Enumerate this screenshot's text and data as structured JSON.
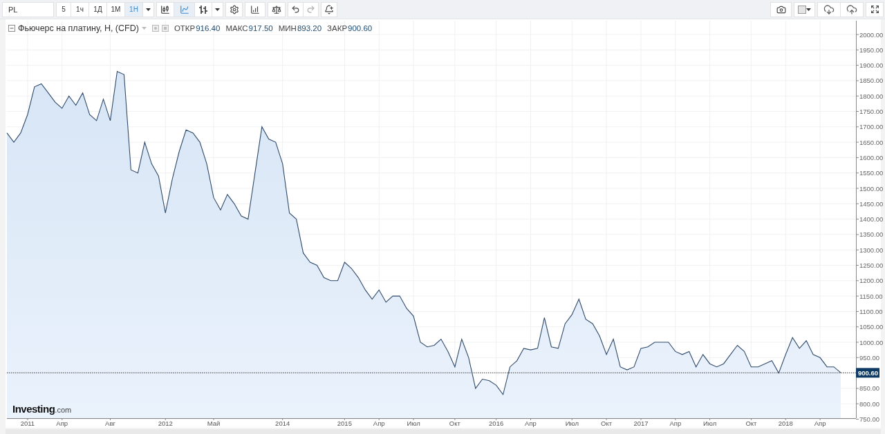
{
  "toolbar": {
    "symbol": {
      "value": "PL"
    },
    "intervals": [
      {
        "label": "5",
        "selected": false
      },
      {
        "label": "1ч",
        "selected": false
      },
      {
        "label": "1Д",
        "selected": false
      },
      {
        "label": "1М",
        "selected": false
      },
      {
        "label": "1Н",
        "selected": true
      }
    ],
    "chart_types": [
      {
        "kind": "candles",
        "selected": false
      },
      {
        "kind": "line",
        "selected": true
      },
      {
        "kind": "bars",
        "selected": false
      }
    ]
  },
  "legend": {
    "title": "Фьючерс на платину, Н, (CFD)",
    "stats": [
      {
        "label": "ОТКР",
        "value": "916.40"
      },
      {
        "label": "МАКС",
        "value": "917.50"
      },
      {
        "label": "МИН",
        "value": "893.20"
      },
      {
        "label": "ЗАКР",
        "value": "900.60"
      }
    ]
  },
  "chart": {
    "logo": {
      "name": "Investing",
      "suffix": ".com"
    },
    "chart_data": {
      "type": "area",
      "grid": true,
      "ref_lines": [
        {
          "axis": "y",
          "value": 900.6,
          "label": "900.60"
        }
      ],
      "categories": [
        null,
        null,
        null,
        "2011",
        null,
        null,
        null,
        null,
        "Апр",
        null,
        null,
        null,
        null,
        null,
        null,
        "Авг",
        null,
        null,
        null,
        null,
        null,
        null,
        null,
        "2012",
        null,
        null,
        null,
        null,
        null,
        null,
        "Май",
        null,
        null,
        null,
        null,
        null,
        null,
        null,
        null,
        null,
        "2014",
        null,
        null,
        null,
        null,
        null,
        null,
        null,
        null,
        "2015",
        null,
        null,
        null,
        null,
        "Апр",
        null,
        null,
        null,
        null,
        "Июл",
        null,
        null,
        null,
        null,
        null,
        "Окт",
        null,
        null,
        null,
        null,
        null,
        "2016",
        null,
        null,
        null,
        null,
        "Апр",
        null,
        null,
        null,
        null,
        null,
        "Июл",
        null,
        null,
        null,
        null,
        "Окт",
        null,
        null,
        null,
        null,
        "2017",
        null,
        null,
        null,
        null,
        "Апр",
        null,
        null,
        null,
        null,
        "Июл",
        null,
        null,
        null,
        null,
        null,
        "Окт",
        null,
        null,
        null,
        null,
        "2018",
        null,
        null,
        null,
        null,
        "Апр",
        null,
        null,
        null
      ],
      "series": [
        {
          "color": "#2f4a6b",
          "values": [
            1680,
            1650,
            1680,
            1740,
            1830,
            1840,
            1810,
            1780,
            1760,
            1800,
            1770,
            1810,
            1740,
            1720,
            1790,
            1720,
            1880,
            1870,
            1560,
            1550,
            1650,
            1580,
            1540,
            1420,
            1530,
            1620,
            1690,
            1680,
            1650,
            1580,
            1470,
            1430,
            1480,
            1450,
            1410,
            1400,
            1550,
            1700,
            1660,
            1650,
            1580,
            1420,
            1400,
            1290,
            1260,
            1250,
            1210,
            1200,
            1200,
            1260,
            1240,
            1210,
            1170,
            1140,
            1170,
            1130,
            1150,
            1150,
            1110,
            1085,
            1000,
            985,
            990,
            1010,
            970,
            920,
            1010,
            950,
            850,
            880,
            875,
            860,
            830,
            920,
            940,
            980,
            975,
            980,
            1080,
            985,
            980,
            1060,
            1090,
            1140,
            1075,
            1060,
            1020,
            960,
            1010,
            920,
            910,
            920,
            980,
            985,
            1000,
            1000,
            1000,
            970,
            960,
            970,
            920,
            960,
            930,
            920,
            930,
            960,
            990,
            970,
            920,
            920,
            930,
            940,
            900,
            960,
            1015,
            980,
            1005,
            960,
            950,
            920,
            920,
            901
          ]
        }
      ],
      "ylim": [
        750,
        2000
      ],
      "yticks": [
        {
          "value": 750,
          "label": "750.00"
        },
        {
          "value": 800,
          "label": "800.00"
        },
        {
          "value": 850,
          "label": "850.00"
        },
        {
          "value": 950,
          "label": "950.00"
        },
        {
          "value": 1000,
          "label": "1000.00"
        },
        {
          "value": 1050,
          "label": "1050.00"
        },
        {
          "value": 1100,
          "label": "1100.00"
        },
        {
          "value": 1150,
          "label": "1150.00"
        },
        {
          "value": 1200,
          "label": "1200.00"
        },
        {
          "value": 1250,
          "label": "1250.00"
        },
        {
          "value": 1300,
          "label": "1300.00"
        },
        {
          "value": 1350,
          "label": "1350.00"
        },
        {
          "value": 1400,
          "label": "1400.00"
        },
        {
          "value": 1450,
          "label": "1450.00"
        },
        {
          "value": 1500,
          "label": "1500.00"
        },
        {
          "value": 1550,
          "label": "1550.00"
        },
        {
          "value": 1600,
          "label": "1600.00"
        },
        {
          "value": 1650,
          "label": "1650.00"
        },
        {
          "value": 1700,
          "label": "1700.00"
        },
        {
          "value": 1750,
          "label": "1750.00"
        },
        {
          "value": 1800,
          "label": "1800.00"
        },
        {
          "value": 1850,
          "label": "1850.00"
        },
        {
          "value": 1900,
          "label": "1900.00"
        },
        {
          "value": 1950,
          "label": "1950.00"
        },
        {
          "value": 2000,
          "label": "2000.00"
        }
      ]
    }
  }
}
